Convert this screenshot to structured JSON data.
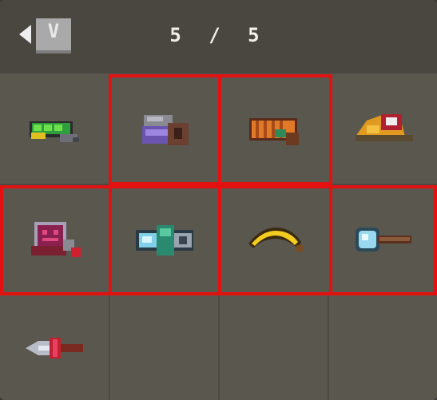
{
  "header": {
    "back_icon": "triangle-left-icon",
    "key_hint": "V",
    "page_indicator": "5 / 5"
  },
  "colors": {
    "panel": "#57544d",
    "header": "#4a4741",
    "selection": "#e3110f"
  },
  "inventory": {
    "slots": [
      {
        "item": "green-blaster-icon",
        "selected": false
      },
      {
        "item": "purple-helmet-icon",
        "selected": true
      },
      {
        "item": "orange-cannon-icon",
        "selected": true
      },
      {
        "item": "orange-cap-icon",
        "selected": false
      },
      {
        "item": "robot-gun-icon",
        "selected": true
      },
      {
        "item": "crystal-blaster-icon",
        "selected": true
      },
      {
        "item": "banana-icon",
        "selected": true
      },
      {
        "item": "ice-hammer-icon",
        "selected": true
      },
      {
        "item": "red-dagger-icon",
        "selected": false
      },
      {
        "item": "empty",
        "selected": false
      },
      {
        "item": "empty",
        "selected": false
      },
      {
        "item": "empty",
        "selected": false
      }
    ]
  }
}
